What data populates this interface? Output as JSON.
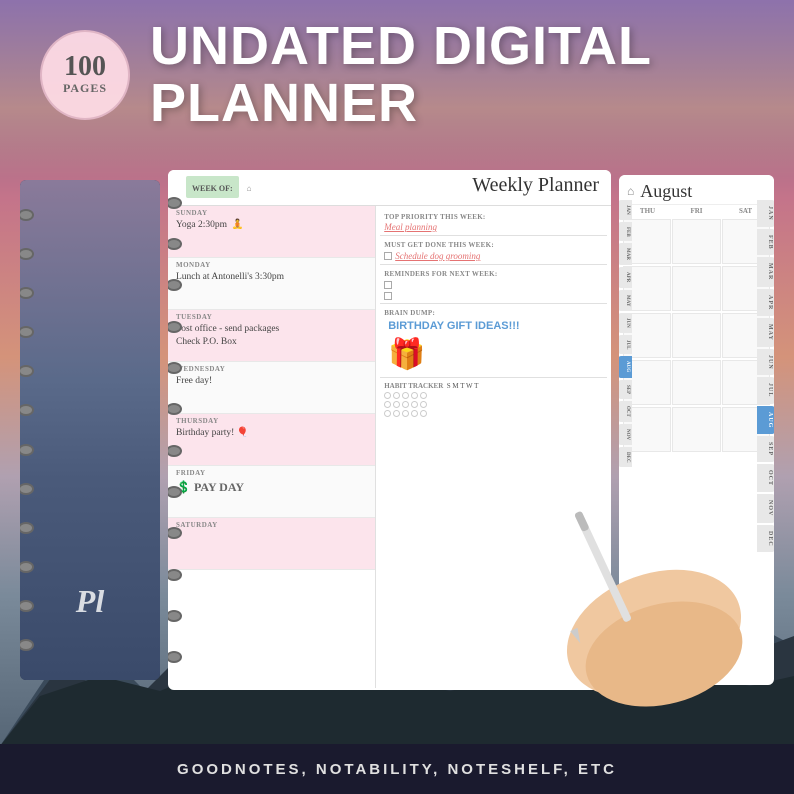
{
  "badge": {
    "number": "100",
    "text": "PAGES"
  },
  "title": {
    "line1": "UNDATED DIGITAL",
    "line2": "PLANNER"
  },
  "weekly_planner": {
    "title": "Weekly Planner",
    "week_of_label": "WEEK OF:",
    "days": [
      {
        "name": "SUNDAY",
        "content": "Yoga 2:30pm",
        "style": "pink"
      },
      {
        "name": "MONDAY",
        "content": "Lunch at Antonelli's 3:30pm",
        "style": "light"
      },
      {
        "name": "TUESDAY",
        "content": "Post office - send packages\nCheck P.O. Box",
        "style": "pink"
      },
      {
        "name": "WEDNESDAY",
        "content": "Free day!",
        "style": "light"
      },
      {
        "name": "THURSDAY",
        "content": "Birthday party!",
        "style": "pink"
      },
      {
        "name": "FRIDAY",
        "content": "$ PAY DAY",
        "style": "light"
      },
      {
        "name": "SATURDAY",
        "content": "",
        "style": "pink"
      }
    ],
    "right_sections": {
      "top_priority_label": "TOP PRIORITY THIS WEEK:",
      "top_priority_content": "Meal planning",
      "must_get_done_label": "MUST GET DONE THIS WEEK:",
      "must_get_done_content": "Schedule dog grooming",
      "reminders_label": "REMINDERS FOR NEXT WEEK:",
      "brain_dump_label": "BRAIN DUMP:",
      "brain_dump_content": "BIRTHDAY GIFT IDEAS!!!",
      "habit_tracker_label": "HABIT TRACKER",
      "habit_days": "S M T W T"
    }
  },
  "calendar": {
    "month": "August",
    "day_headers": [
      "THU",
      "FRI",
      "SAT"
    ],
    "side_tabs": [
      "JAN",
      "FEB",
      "MAR",
      "APR",
      "MAY",
      "JUN",
      "JUL",
      "AUG",
      "SEP",
      "OCT",
      "NOV",
      "DEC"
    ]
  },
  "left_notebook": {
    "title": "Pl"
  },
  "bottom_bar": {
    "text": "GOODNOTES, NOTABILITY, NOTESHELF, ETC"
  }
}
